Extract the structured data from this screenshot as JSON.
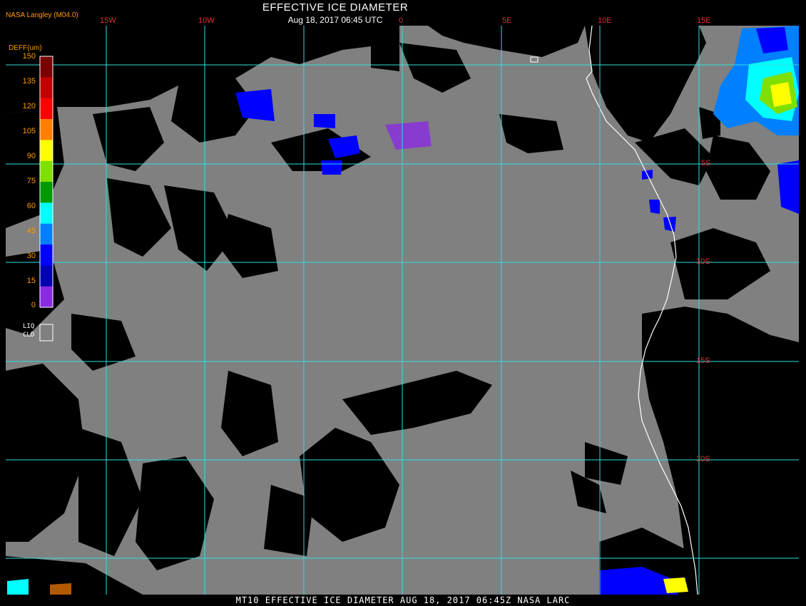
{
  "header": {
    "producer": "NASA Langley (M04.0)",
    "title": "EFFECTIVE ICE DIAMETER",
    "subtitle": "Aug 18, 2017 06:45 UTC"
  },
  "footer": {
    "caption": "MT10  EFFECTIVE ICE DIAMETER   AUG 18, 2017 06:45Z   NASA LARC"
  },
  "legend": {
    "title": "DEFF(um)",
    "ticks": [
      "150",
      "135",
      "120",
      "105",
      "90",
      "75",
      "60",
      "45",
      "30",
      "15",
      "0"
    ],
    "colors": [
      "#7a0000",
      "#c00000",
      "#ff0000",
      "#ff7f00",
      "#ffff00",
      "#7fdf00",
      "#009a00",
      "#00ffff",
      "#0080ff",
      "#0000ff",
      "#0000b0",
      "#8a2be2"
    ],
    "liquid_cloud_label": [
      "LIQ",
      "CLD"
    ],
    "liquid_cloud_color": "#808080"
  },
  "graticule": {
    "lon_labels": [
      "15W",
      "10W",
      "0",
      "5E",
      "10E",
      "15E"
    ],
    "lat_labels": [
      "5S",
      "10S",
      "15S",
      "20S"
    ],
    "line_color": "#2ee0e0"
  },
  "colors": {
    "cloud_gray": "#808080",
    "clear": "#000000",
    "coast": "#ffffff"
  }
}
